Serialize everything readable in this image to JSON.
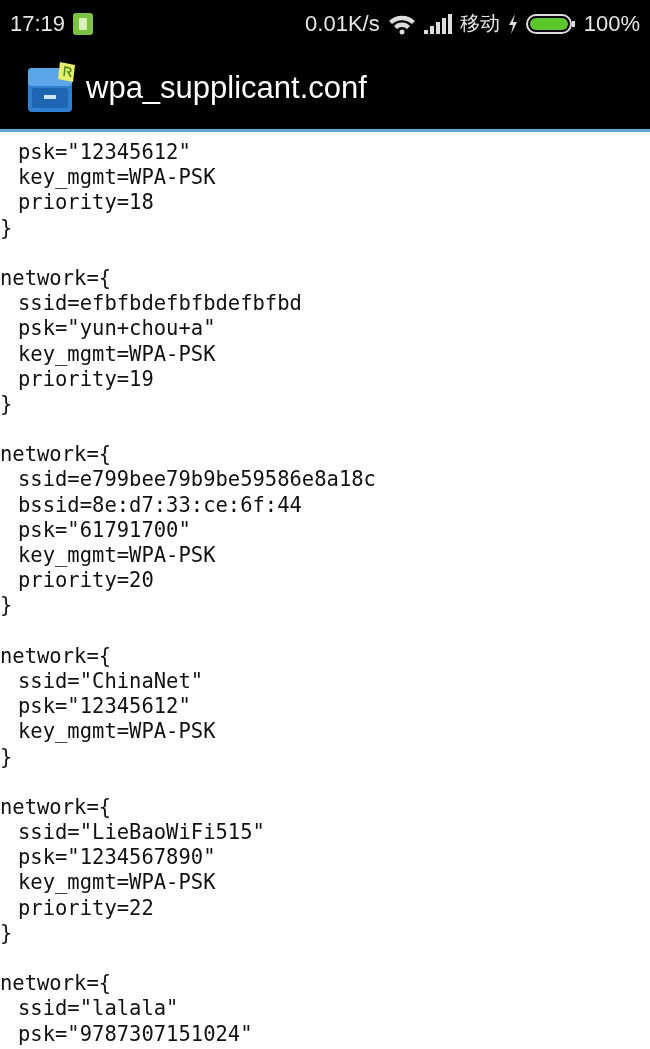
{
  "status_bar": {
    "time": "17:19",
    "speed": "0.01K/s",
    "carrier": "移动",
    "battery": "100%",
    "charging": true
  },
  "app_bar": {
    "title": "wpa_supplicant.conf"
  },
  "blocks": [
    {
      "fields": [
        "psk=\"12345612\"",
        "key_mgmt=WPA-PSK",
        "priority=18"
      ],
      "close": "}"
    },
    {
      "header": "network={",
      "fields": [
        "ssid=efbfbdefbfbdefbfbd",
        "psk=\"yun+chou+a\"",
        "key_mgmt=WPA-PSK",
        "priority=19"
      ],
      "close": "}"
    },
    {
      "header": "network={",
      "fields": [
        "ssid=e799bee79b9be59586e8a18c",
        "bssid=8e:d7:33:ce:6f:44",
        "psk=\"61791700\"",
        "key_mgmt=WPA-PSK",
        "priority=20"
      ],
      "close": "}"
    },
    {
      "header": "network={",
      "fields": [
        "ssid=\"ChinaNet\"",
        "psk=\"12345612\"",
        "key_mgmt=WPA-PSK"
      ],
      "close": "}"
    },
    {
      "header": "network={",
      "fields": [
        "ssid=\"LieBaoWiFi515\"",
        "psk=\"1234567890\"",
        "key_mgmt=WPA-PSK",
        "priority=22"
      ],
      "close": "}"
    },
    {
      "header": "network={",
      "fields": [
        "ssid=\"lalala\"",
        "psk=\"9787307151024\""
      ]
    }
  ]
}
